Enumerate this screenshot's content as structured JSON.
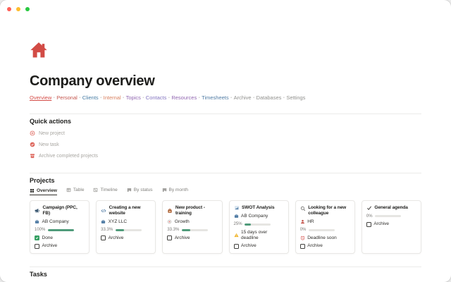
{
  "window_controls": {
    "close": "#ff5f57",
    "minimize": "#febc2e",
    "zoom": "#28c840"
  },
  "header": {
    "page_icon": "red-house",
    "title": "Company overview",
    "nav_separator": "•",
    "nav": [
      {
        "label": "Overview",
        "color": "#d44c47"
      },
      {
        "label": "Personal",
        "color": "#c4554d"
      },
      {
        "label": "Clients",
        "color": "#477da5"
      },
      {
        "label": "Internal",
        "color": "#d9805f"
      },
      {
        "label": "Topics",
        "color": "#9065b0"
      },
      {
        "label": "Contacts",
        "color": "#8475c1"
      },
      {
        "label": "Resources",
        "color": "#9065b0"
      },
      {
        "label": "Timesheets",
        "color": "#527da5"
      },
      {
        "label": "Archive",
        "color": "#91918e"
      },
      {
        "label": "Databases",
        "color": "#91918e"
      },
      {
        "label": "Settings",
        "color": "#91918e"
      }
    ]
  },
  "quick_actions": {
    "title": "Quick actions",
    "items": [
      {
        "label": "New project",
        "icon": "plus-circle-icon"
      },
      {
        "label": "New task",
        "icon": "check-circle-icon"
      },
      {
        "label": "Archive completed projects",
        "icon": "archive-box-icon"
      }
    ]
  },
  "projects": {
    "title": "Projects",
    "tabs": [
      {
        "label": "Overview",
        "icon": "gallery-icon",
        "active": true
      },
      {
        "label": "Table",
        "icon": "table-icon"
      },
      {
        "label": "Timeline",
        "icon": "timeline-icon"
      },
      {
        "label": "By status",
        "icon": "board-icon"
      },
      {
        "label": "By month",
        "icon": "board-icon"
      }
    ],
    "cards": [
      {
        "title": "Campaign (PPC, FB)",
        "icon": "megaphone-icon",
        "org": "AB Company",
        "org_icon": "briefcase-icon",
        "progress_label": "100%",
        "status_label": "Done",
        "archive_label": "Archive"
      },
      {
        "title": "Creating a new website",
        "icon": "code-icon",
        "org": "XYZ LLC",
        "org_icon": "briefcase-icon",
        "progress_label": "33.3%",
        "archive_label": "Archive"
      },
      {
        "title": "New product - training",
        "icon": "backpack-icon",
        "org": "Growth",
        "org_icon": "target-icon",
        "progress_label": "33.3%",
        "archive_label": "Archive"
      },
      {
        "title": "SWOT Analysis",
        "icon": "chart-icon",
        "org": "AB Company",
        "org_icon": "briefcase-icon",
        "progress_label": "25%",
        "status_label": "15 days over deadline",
        "archive_label": "Archive"
      },
      {
        "title": "Looking for a new colleague",
        "icon": "search-icon",
        "org": "HR",
        "org_icon": "person-icon",
        "progress_label": "0%",
        "status_label": "Deadline soon",
        "archive_label": "Archive"
      },
      {
        "title": "General agenda",
        "icon": "check-icon",
        "progress_label": "0%",
        "archive_label": "Archive"
      }
    ]
  },
  "tasks": {
    "title": "Tasks"
  },
  "colors": {
    "accent_red": "#d24b45",
    "link_blue": "#527da5",
    "progress_green": "#4f9b7a",
    "checkbox_green": "#36a063",
    "warning_amber": "#f0b429",
    "divider": "#ebebe9"
  }
}
